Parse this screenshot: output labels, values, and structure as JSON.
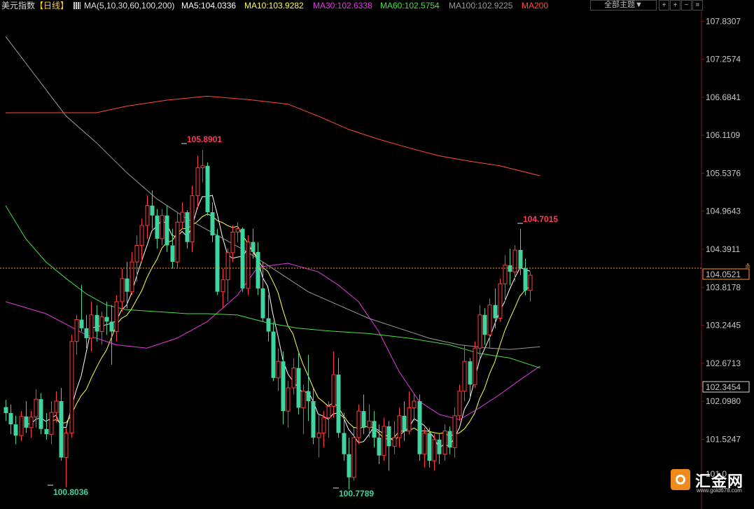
{
  "header": {
    "title": "美元指数",
    "period": "【日线】",
    "ma_params": "MA(5,10,30,60,100,200)",
    "ma5": "MA5:104.0336",
    "ma10": "MA10:103.9282",
    "ma30": "MA30:102.6338",
    "ma60": "MA60:102.5754",
    "ma100": "MA100:102.9225",
    "ma200": "MA200",
    "theme_select": "全部主题▼"
  },
  "colors": {
    "up": "#ff3b3b",
    "down": "#3fd4a0",
    "ma5": "#ffffff",
    "ma10": "#ffff4d",
    "ma30": "#e33ae3",
    "ma60": "#45e045",
    "ma100": "#9a9a9a",
    "ma200": "#ff4a3a",
    "current_price_line": "#ff9a30"
  },
  "yaxis": {
    "ticks": [
      "107.8307",
      "107.2574",
      "106.6841",
      "106.1109",
      "105.5376",
      "104.9643",
      "104.3911",
      "103.8178",
      "103.2445",
      "102.6713",
      "102.0980",
      "101.5247",
      "101.0"
    ],
    "current_price": "104.0521",
    "ref_price": "102.3454"
  },
  "annotations": {
    "high1": "105.8901",
    "high2": "104.7015",
    "low1": "100.8036",
    "low2": "100.7789"
  },
  "logo": {
    "name": "汇金网",
    "url": "www.gold678.com"
  },
  "chart_data": {
    "type": "candlestick",
    "ylim": [
      100.6,
      107.95
    ],
    "ma_values": {
      "MA5": 104.0336,
      "MA10": 103.9282,
      "MA30": 102.6338,
      "MA60": 102.5754,
      "MA100": 102.9225
    },
    "highs": [
      105.8901,
      104.7015
    ],
    "lows": [
      100.8036,
      100.7789
    ],
    "current": 104.0521,
    "ohlc": [
      [
        102.01,
        102.12,
        101.8,
        101.92
      ],
      [
        101.92,
        102.05,
        101.6,
        101.75
      ],
      [
        101.75,
        101.88,
        101.45,
        101.58
      ],
      [
        101.58,
        101.95,
        101.5,
        101.87
      ],
      [
        101.87,
        102.1,
        101.62,
        101.7
      ],
      [
        101.7,
        101.95,
        101.55,
        101.86
      ],
      [
        101.86,
        102.28,
        101.7,
        102.13
      ],
      [
        102.13,
        102.22,
        101.6,
        101.68
      ],
      [
        101.68,
        101.92,
        101.52,
        101.6
      ],
      [
        101.6,
        102.1,
        101.45,
        101.93
      ],
      [
        101.93,
        102.25,
        101.78,
        102.1
      ],
      [
        102.1,
        102.3,
        101.2,
        101.25
      ],
      [
        101.25,
        101.7,
        100.8,
        101.62
      ],
      [
        101.62,
        103.1,
        101.55,
        103.0
      ],
      [
        103.0,
        103.4,
        102.8,
        103.33
      ],
      [
        103.33,
        103.85,
        103.15,
        103.2
      ],
      [
        103.2,
        103.4,
        102.9,
        103.05
      ],
      [
        103.05,
        103.6,
        102.85,
        103.4
      ],
      [
        103.4,
        103.55,
        103.0,
        103.15
      ],
      [
        103.15,
        103.45,
        102.95,
        103.37
      ],
      [
        103.37,
        103.6,
        103.1,
        103.3
      ],
      [
        103.3,
        103.55,
        102.65,
        103.15
      ],
      [
        103.15,
        103.7,
        103.0,
        103.6
      ],
      [
        103.6,
        104.1,
        103.45,
        103.95
      ],
      [
        103.95,
        104.2,
        103.5,
        103.75
      ],
      [
        103.75,
        104.35,
        103.7,
        104.2
      ],
      [
        104.2,
        104.6,
        103.9,
        104.45
      ],
      [
        104.45,
        104.85,
        104.2,
        104.75
      ],
      [
        104.75,
        105.2,
        104.55,
        105.05
      ],
      [
        105.05,
        105.28,
        104.7,
        104.9
      ],
      [
        104.9,
        105.0,
        104.4,
        104.55
      ],
      [
        104.55,
        105.0,
        104.45,
        104.9
      ],
      [
        104.9,
        105.05,
        104.35,
        104.45
      ],
      [
        104.45,
        104.7,
        104.1,
        104.2
      ],
      [
        104.2,
        104.95,
        104.1,
        104.8
      ],
      [
        104.8,
        105.1,
        104.7,
        104.95
      ],
      [
        104.95,
        104.98,
        104.4,
        104.5
      ],
      [
        104.5,
        105.35,
        104.35,
        105.2
      ],
      [
        105.2,
        105.8,
        105.0,
        105.62
      ],
      [
        105.62,
        105.89,
        105.4,
        105.65
      ],
      [
        105.65,
        105.7,
        104.9,
        104.95
      ],
      [
        104.95,
        105.1,
        104.5,
        104.6
      ],
      [
        104.6,
        104.7,
        103.7,
        103.75
      ],
      [
        103.75,
        104.1,
        103.5,
        103.93
      ],
      [
        103.93,
        104.4,
        103.6,
        104.34
      ],
      [
        104.34,
        104.75,
        104.2,
        104.65
      ],
      [
        104.65,
        104.8,
        104.5,
        104.7
      ],
      [
        104.7,
        104.72,
        103.75,
        103.8
      ],
      [
        103.8,
        104.6,
        103.7,
        104.5
      ],
      [
        104.5,
        104.7,
        104.25,
        104.35
      ],
      [
        104.35,
        104.5,
        103.7,
        103.8
      ],
      [
        103.8,
        104.2,
        103.3,
        103.35
      ],
      [
        103.35,
        103.7,
        103.0,
        103.15
      ],
      [
        103.15,
        103.3,
        102.4,
        102.45
      ],
      [
        102.45,
        102.9,
        102.25,
        102.7
      ],
      [
        102.7,
        102.85,
        101.75,
        101.95
      ],
      [
        101.95,
        102.4,
        101.7,
        102.3
      ],
      [
        102.3,
        102.75,
        102.2,
        102.6
      ],
      [
        102.6,
        102.82,
        101.9,
        102.0
      ],
      [
        102.0,
        102.35,
        101.6,
        102.25
      ],
      [
        102.25,
        102.8,
        101.8,
        102.1
      ],
      [
        102.1,
        102.3,
        101.45,
        101.55
      ],
      [
        101.55,
        101.9,
        101.25,
        101.62
      ],
      [
        101.62,
        101.95,
        101.4,
        101.85
      ],
      [
        101.85,
        102.1,
        101.55,
        102.02
      ],
      [
        102.02,
        102.85,
        101.85,
        102.5
      ],
      [
        102.5,
        102.75,
        101.55,
        101.62
      ],
      [
        101.62,
        101.92,
        101.2,
        101.3
      ],
      [
        101.3,
        101.55,
        100.77,
        100.95
      ],
      [
        100.95,
        101.7,
        100.9,
        101.55
      ],
      [
        101.55,
        102.05,
        101.45,
        101.95
      ],
      [
        101.95,
        102.2,
        101.6,
        101.7
      ],
      [
        101.7,
        102.05,
        101.55,
        101.8
      ],
      [
        101.8,
        101.95,
        101.4,
        101.55
      ],
      [
        101.55,
        101.75,
        101.15,
        101.28
      ],
      [
        101.28,
        101.85,
        101.2,
        101.72
      ],
      [
        101.72,
        101.8,
        101.05,
        101.42
      ],
      [
        101.42,
        101.8,
        101.3,
        101.55
      ],
      [
        101.55,
        102.0,
        101.4,
        101.88
      ],
      [
        101.88,
        102.1,
        101.5,
        101.65
      ],
      [
        101.65,
        102.25,
        101.6,
        102.0
      ],
      [
        102.0,
        102.2,
        101.8,
        102.1
      ],
      [
        102.1,
        102.2,
        101.2,
        101.3
      ],
      [
        101.3,
        101.7,
        101.1,
        101.62
      ],
      [
        101.62,
        101.7,
        101.1,
        101.2
      ],
      [
        101.2,
        101.6,
        101.05,
        101.52
      ],
      [
        101.52,
        101.6,
        101.15,
        101.3
      ],
      [
        101.3,
        101.75,
        101.2,
        101.65
      ],
      [
        101.65,
        101.72,
        101.3,
        101.4
      ],
      [
        101.4,
        102.0,
        101.25,
        101.88
      ],
      [
        101.88,
        102.35,
        101.8,
        102.25
      ],
      [
        102.25,
        102.95,
        102.1,
        102.7
      ],
      [
        102.7,
        102.75,
        102.15,
        102.35
      ],
      [
        102.35,
        103.0,
        102.3,
        102.9
      ],
      [
        102.9,
        103.55,
        102.75,
        103.4
      ],
      [
        103.4,
        103.5,
        102.95,
        103.1
      ],
      [
        103.1,
        103.65,
        102.9,
        103.55
      ],
      [
        103.55,
        103.8,
        103.2,
        103.35
      ],
      [
        103.35,
        103.95,
        103.3,
        103.87
      ],
      [
        103.87,
        104.3,
        103.6,
        104.15
      ],
      [
        104.15,
        104.4,
        103.85,
        104.05
      ],
      [
        104.05,
        104.45,
        103.9,
        104.38
      ],
      [
        104.38,
        104.7,
        104.0,
        104.1
      ],
      [
        104.1,
        104.25,
        103.7,
        103.77
      ],
      [
        103.77,
        104.05,
        103.6,
        104.0
      ]
    ]
  }
}
